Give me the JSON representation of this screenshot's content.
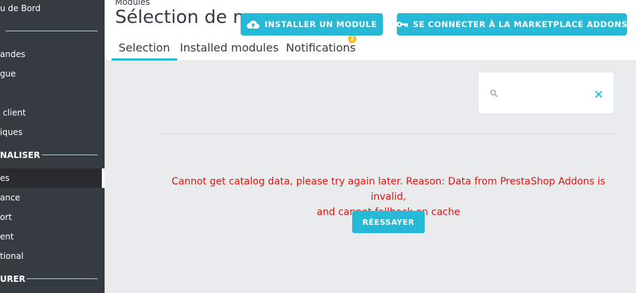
{
  "sidebar": {
    "items": [
      {
        "label": "u de Bord"
      },
      {
        "label": "andes"
      },
      {
        "label": "gue"
      },
      {
        "label": "client"
      },
      {
        "label": "iques"
      },
      {
        "label": "es"
      },
      {
        "label": "ance"
      },
      {
        "label": "ort"
      },
      {
        "label": "ent"
      },
      {
        "label": "tional"
      }
    ],
    "sections": [
      {
        "label": "NALISER"
      },
      {
        "label": "URER"
      }
    ]
  },
  "header": {
    "breadcrumb": "Modules",
    "title": "Sélection de mo",
    "install_button": "INSTALLER UN MODULE",
    "connect_button": "SE CONNECTER À LA MARKETPLACE ADDONS",
    "tabs": [
      {
        "label": "Selection"
      },
      {
        "label": "Installed modules"
      },
      {
        "label": "Notifications",
        "badge": "2"
      }
    ]
  },
  "search": {
    "placeholder": ""
  },
  "error": {
    "line1": "Cannot get catalog data, please try again later. Reason: Data from PrestaShop Addons is invalid,",
    "line2": "and cannot fallback on cache"
  },
  "retry_button": "RÉESSAYER",
  "colors": {
    "accent": "#25b9d7",
    "error": "#e5130f",
    "sidebar": "#363a41",
    "badge": "#fbbb22"
  }
}
